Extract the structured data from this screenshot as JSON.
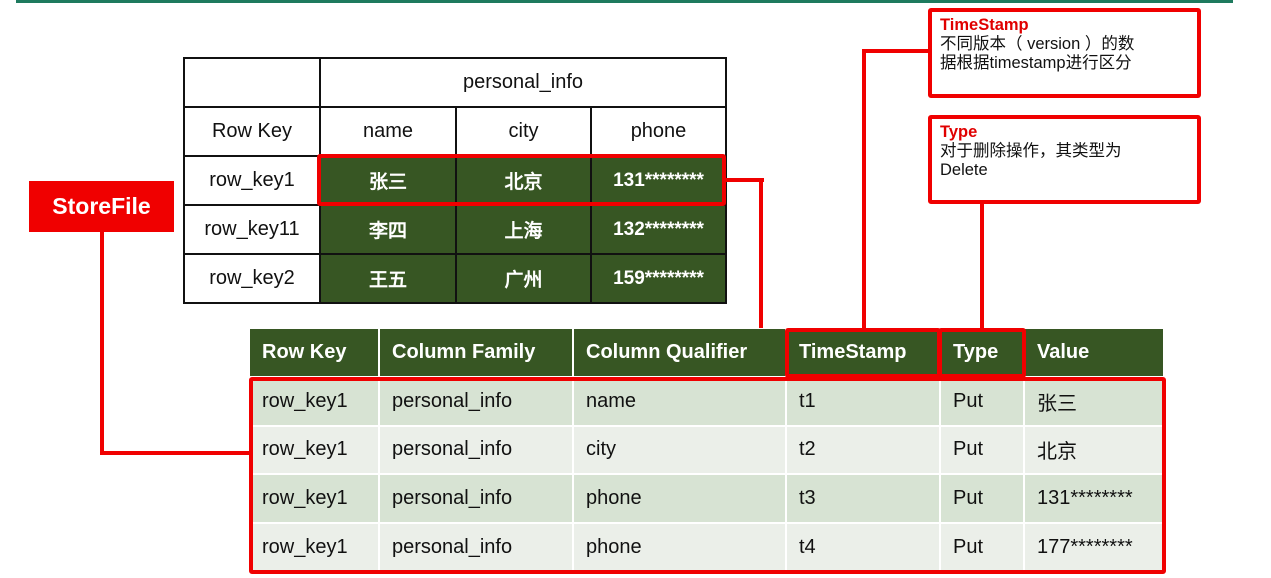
{
  "logical_table": {
    "family_header": "personal_info",
    "columns": [
      "Row Key",
      "name",
      "city",
      "phone"
    ],
    "rows": [
      [
        "row_key1",
        "张三",
        "北京",
        "131********"
      ],
      [
        "row_key11",
        "李四",
        "上海",
        "132********"
      ],
      [
        "row_key2",
        "王五",
        "广州",
        "159********"
      ]
    ]
  },
  "storefile_label": "StoreFile",
  "store_table": {
    "columns": [
      "Row Key",
      "Column Family",
      "Column Qualifier",
      "TimeStamp",
      "Type",
      "Value"
    ],
    "rows": [
      [
        "row_key1",
        "personal_info",
        "name",
        "t1",
        "Put",
        "张三"
      ],
      [
        "row_key1",
        "personal_info",
        "city",
        "t2",
        "Put",
        "北京"
      ],
      [
        "row_key1",
        "personal_info",
        "phone",
        "t3",
        "Put",
        "131********"
      ],
      [
        "row_key1",
        "personal_info",
        "phone",
        "t4",
        "Put",
        "177********"
      ]
    ]
  },
  "callouts": {
    "timestamp": {
      "title": "TimeStamp",
      "line1": "不同版本（ version ）的数",
      "line2": "据根据timestamp进行区分"
    },
    "type": {
      "title": "Type",
      "line1": "对于删除操作，其类型为",
      "line2": "Delete"
    }
  },
  "colors": {
    "accent_red": "#f00000",
    "header_green": "#375623",
    "row_odd": "#d7e3d3",
    "row_even": "#ebefe9",
    "top_bar": "#1e7a5e"
  }
}
